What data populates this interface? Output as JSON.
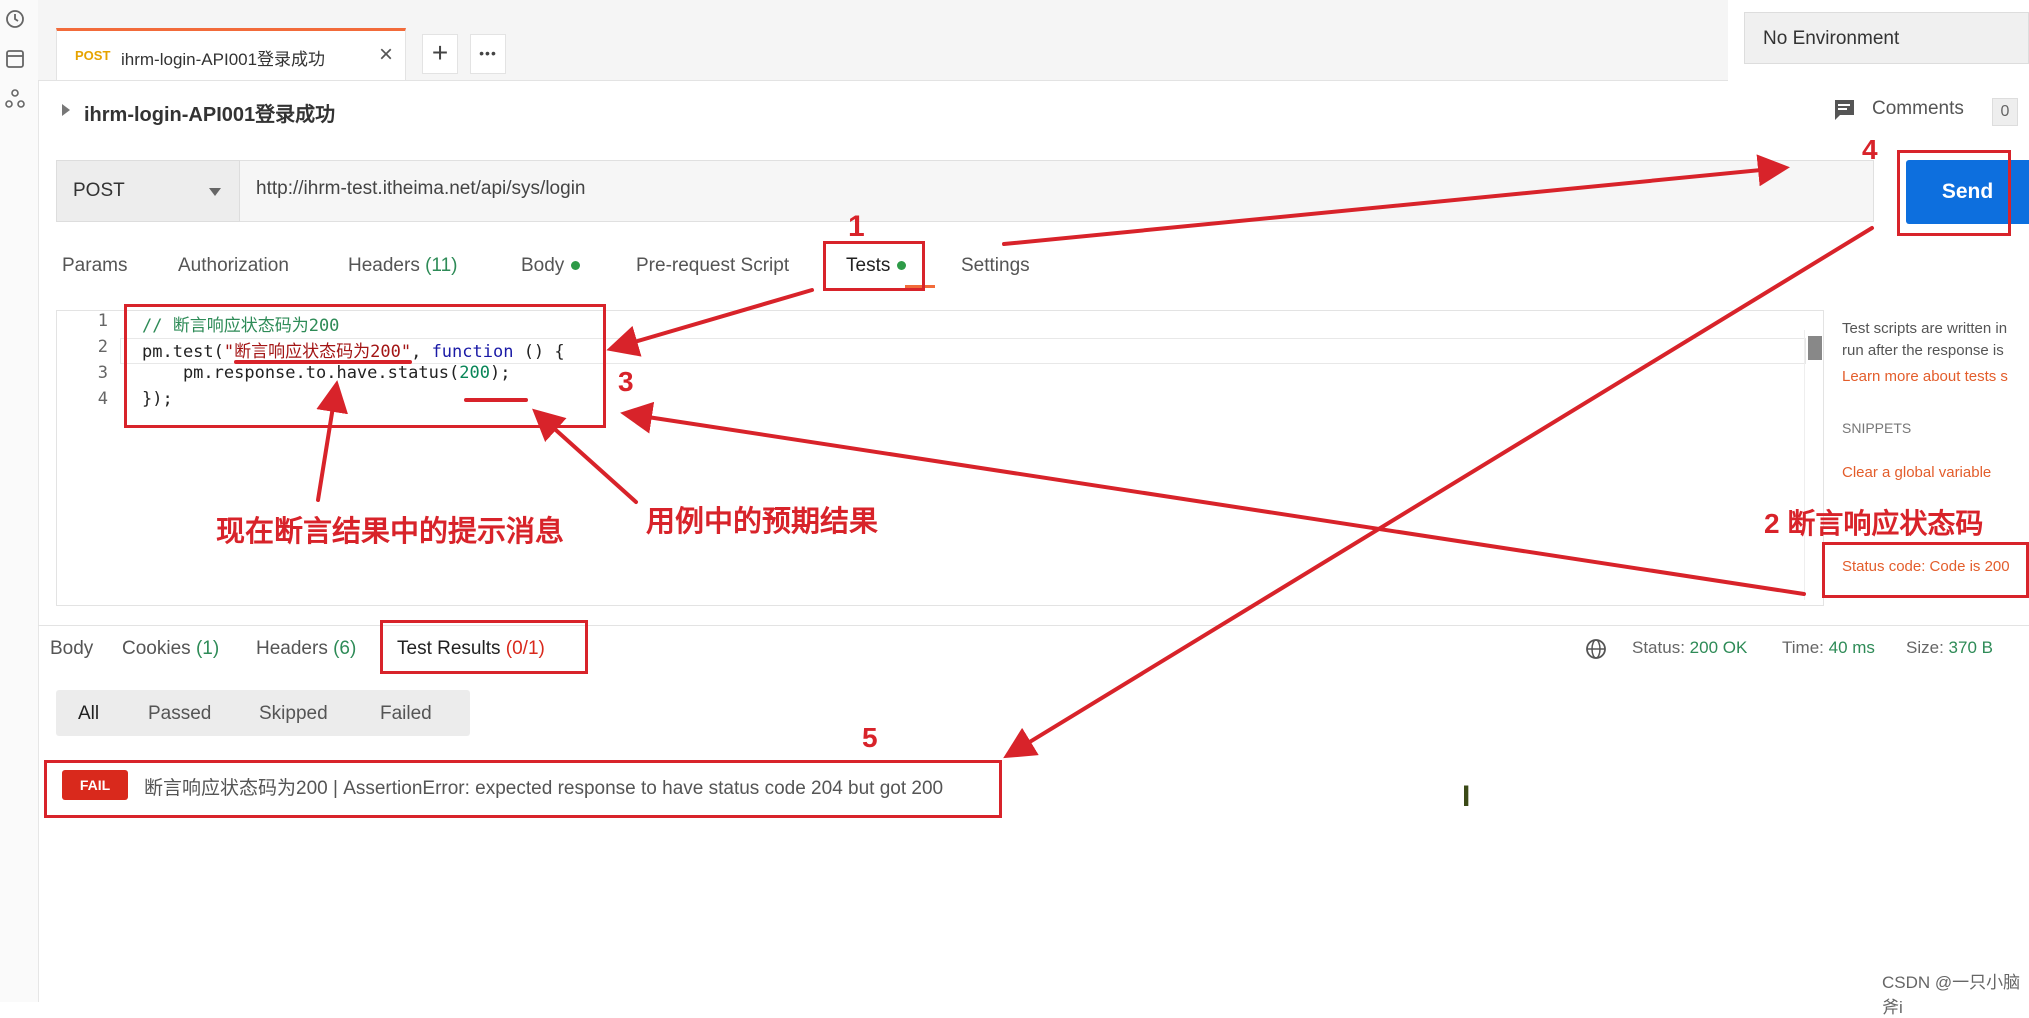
{
  "tab": {
    "method": "POST",
    "name": "ihrm-login-API001登录成功",
    "close": "×",
    "add": "+",
    "more": "•••"
  },
  "environment": {
    "label": "No Environment"
  },
  "request": {
    "title": "ihrm-login-API001登录成功",
    "comments_label": "Comments",
    "comments_count": "0",
    "method": "POST",
    "url": "http://ihrm-test.itheima.net/api/sys/login",
    "send_label": "Send"
  },
  "request_tabs": {
    "params": "Params",
    "authorization": "Authorization",
    "headers": "Headers",
    "headers_count": "(11)",
    "body": "Body",
    "pre_request": "Pre-request Script",
    "tests": "Tests",
    "settings": "Settings"
  },
  "editor": {
    "line_numbers": [
      "1",
      "2",
      "3",
      "4"
    ],
    "line1": "// 断言响应状态码为200",
    "line2_a": "pm.test(",
    "line2_str": "\"断言响应状态码为200\"",
    "line2_b": ", ",
    "line2_kw": "function",
    "line2_c": " () {",
    "line3_a": "    pm.response.to.have.status(",
    "line3_num": "200",
    "line3_b": ");",
    "line4": "});"
  },
  "right_pane": {
    "desc1": "Test scripts are written in",
    "desc2": "run after the response is",
    "learn_more": "Learn more about tests s",
    "snippets": "SNIPPETS",
    "snippet1": "Clear a global variable",
    "snippet2": "Status code: Code is 200"
  },
  "response_tabs": {
    "body": "Body",
    "cookies": "Cookies",
    "cookies_count": "(1)",
    "headers": "Headers",
    "headers_count": "(6)",
    "test_results": "Test Results",
    "test_results_count": "(0/1)"
  },
  "status": {
    "status_label": "Status:",
    "status_value": "200 OK",
    "time_label": "Time:",
    "time_value": "40 ms",
    "size_label": "Size:",
    "size_value": "370 B"
  },
  "filters": {
    "all": "All",
    "passed": "Passed",
    "skipped": "Skipped",
    "failed": "Failed"
  },
  "result": {
    "badge": "FAIL",
    "message": "断言响应状态码为200 | AssertionError: expected response to have status code 204 but got 200"
  },
  "annotations": {
    "n1": "1",
    "n2": "2 断言响应状态码",
    "n3": "3",
    "n4": "4",
    "n5": "5",
    "hint_message": "现在断言结果中的提示消息",
    "expected_result": "用例中的预期结果"
  },
  "watermark": "CSDN @一只小脑斧i",
  "colors": {
    "accent": "#f26b3a",
    "send": "#0d6fde",
    "annotation": "#d8232a",
    "fail": "#d9291c",
    "ok": "#2e8b57"
  }
}
